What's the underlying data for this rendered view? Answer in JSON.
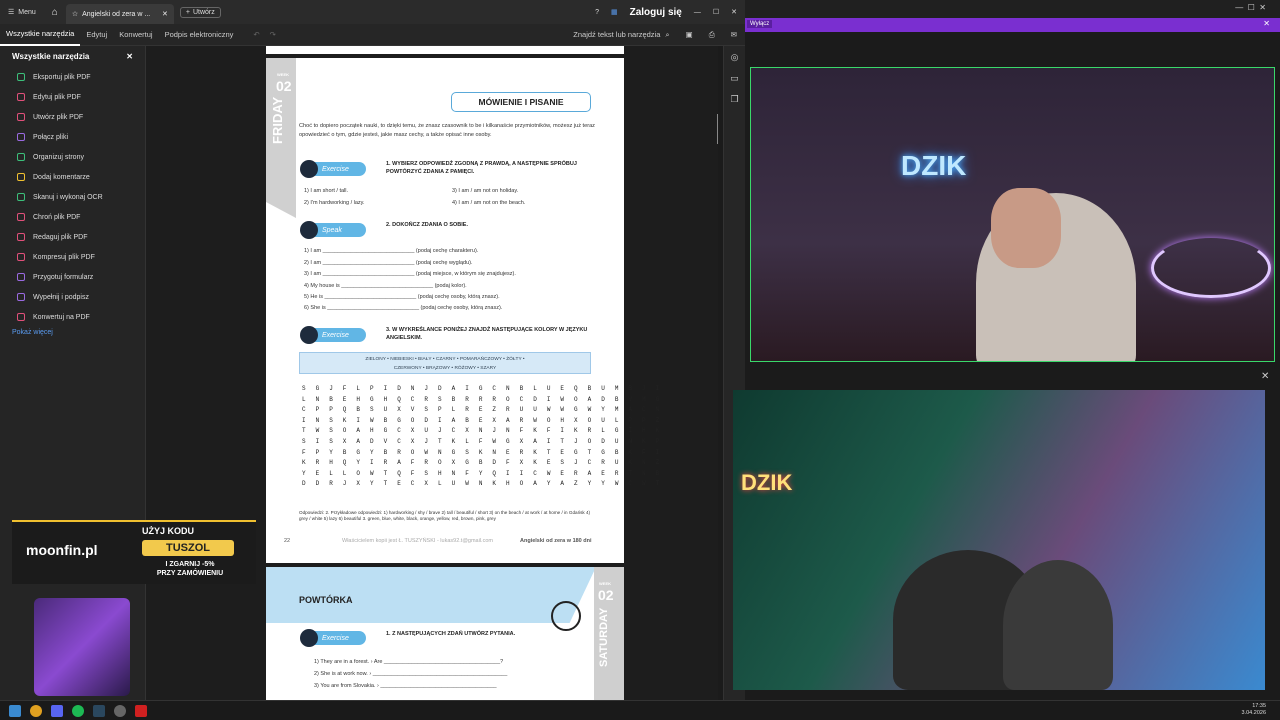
{
  "titlebar": {
    "menu": "Menu",
    "tab": "Angielski od zera w ...",
    "new_tab": "Utwórz",
    "login": "Zaloguj się"
  },
  "menubar": {
    "items": [
      "Wszystkie narzędzia",
      "Edytuj",
      "Konwertuj",
      "Podpis elektroniczny"
    ],
    "find": "Znajdź tekst lub narzędzia"
  },
  "panel": {
    "title": "Wszystkie narzędzia",
    "more": "Pokaż więcej",
    "tools": [
      {
        "label": "Eksportuj plik PDF",
        "color": "#3cbf7a"
      },
      {
        "label": "Edytuj plik PDF",
        "color": "#e0507a"
      },
      {
        "label": "Utwórz plik PDF",
        "color": "#e0507a"
      },
      {
        "label": "Połącz pliki",
        "color": "#9a6ae0"
      },
      {
        "label": "Organizuj strony",
        "color": "#3cbf7a"
      },
      {
        "label": "Dodaj komentarze",
        "color": "#f0c030"
      },
      {
        "label": "Skanuj i wykonaj OCR",
        "color": "#3cbf7a"
      },
      {
        "label": "Chroń plik PDF",
        "color": "#e0507a"
      },
      {
        "label": "Redaguj plik PDF",
        "color": "#e0507a"
      },
      {
        "label": "Kompresuj plik PDF",
        "color": "#e0507a"
      },
      {
        "label": "Przygotuj formularz",
        "color": "#9a6ae0"
      },
      {
        "label": "Wypełnij i podpisz",
        "color": "#9a6ae0"
      },
      {
        "label": "Konwertuj na PDF",
        "color": "#e0507a"
      }
    ]
  },
  "page1": {
    "week": "WEEK",
    "num": "02",
    "day": "FRIDAY",
    "heading": "MÓWIENIE I PISANIE",
    "intro": "Choć to dopiero początek nauki, to dzięki temu, że znasz czasownik to be i kilkanaście przymiotników, możesz już teraz opowiedzieć o tym, gdzie jesteś, jakie masz cechy, a także opisać inne osoby.",
    "ex_label": "Exercise",
    "speak_label": "Speak",
    "task1": "1. WYBIERZ ODPOWIEDŹ ZGODNĄ Z PRAWDĄ, A NASTĘPNIE SPRÓBUJ POWTÓRZYĆ ZDANIA Z PAMIĘCI.",
    "t1": [
      "1) I am short / tall.",
      "2) I'm hardworking / lazy.",
      "3) I am / am not on holiday.",
      "4) I am / am not on the beach."
    ],
    "task2": "2. DOKOŃCZ ZDANIA O SOBIE.",
    "t2": [
      "1) I am ______________________________ (podaj cechę charakteru).",
      "2) I am ______________________________ (podaj cechę wyglądu).",
      "3) I am ______________________________ (podaj miejsce, w którym się znajdujesz).",
      "4) My house is ______________________________ (podaj kolor).",
      "5) He is ______________________________ (podaj cechę osoby, którą znasz).",
      "6) She is ______________________________ (podaj cechę osoby, którą znasz)."
    ],
    "task3": "3. W WYKREŚLANCE PONIŻEJ ZNAJDŹ NASTĘPUJĄCE KOLORY W JĘZYKU ANGIELSKIM.",
    "colors1": "ZIELONY • NIEBIESKI • BIAŁY • CZARNY • POMARAŃCZOWY • ŻÓŁTY •",
    "colors2": "CZERWONY • BRĄZOWY • RÓŻOWY • SZARY",
    "grid": [
      "S G J F L P I D N J D A I G C N B L U E Q B U M B J I",
      "L N B E H G H Q C R S B R R R O C D I W O A D B V M G",
      "C P P Q B S U X V S P L R E Z R U U W W G W Y M A C N",
      "I N S K I W B G O D I A B E X A R W O H X O U L P P Z",
      "T W S O A H G C X U J C X N J N F K F I K R L G I H K",
      "S I S X A D V C X J T K L F W G X A I T J O D U N K P",
      "F P Y B G Y B R O W N G S K N E R K T E G T G B K F I",
      "K R H Q Y I R A F R O X G B D F X K E S J C R U K N Z",
      "Y E L L O W T Q F S H N F Y Q I I C W E R A E R T N B",
      "D D R J X Y T E C X L U W N K H O A Y A Z Y Y W C W T"
    ],
    "answers": "Odpowiedzi: 2. Przykładowe odpowiedzi: 1) hardworking / shy / brave 2) tall / beautiful / short 3) on the beach / at work / at home / in Gdańsk 4) grey / white 5) lazy 6) beautiful 3. green, blue, white, black, orange, yellow, red, brown, pink, grey",
    "page_num": "22",
    "watermark": "Właścicielem kopii jest Ł. TUSZYŃSKI - lukas92.t@gmail.com",
    "footer_title": "Angielski od zera w 180 dni"
  },
  "page2": {
    "heading": "POWTÓRKA",
    "week": "WEEK",
    "num": "02",
    "day": "SATURDAY",
    "ex_label": "Exercise",
    "task": "1. Z NASTĘPUJĄCYCH ZDAŃ UTWÓRZ PYTANIA.",
    "lines": [
      "1) They are in a forest. › Are ______________________________________?",
      "2) She is at work now. › ____________________________________________",
      "3) You are from Slovakia. › ______________________________________"
    ]
  },
  "stream": {
    "disable": "Wyłącz",
    "neon1": "DZIK",
    "neon2": "DZIK"
  },
  "promo": {
    "code_label": "UŻYJ KODU",
    "code": "TUSZOL",
    "brand": "moonfin.pl",
    "line1": "I ZGARNIJ -5%",
    "line2": "PRZY ZAMÓWIENIU"
  },
  "clock": {
    "time": "17:35",
    "date": "3.04.2026"
  }
}
